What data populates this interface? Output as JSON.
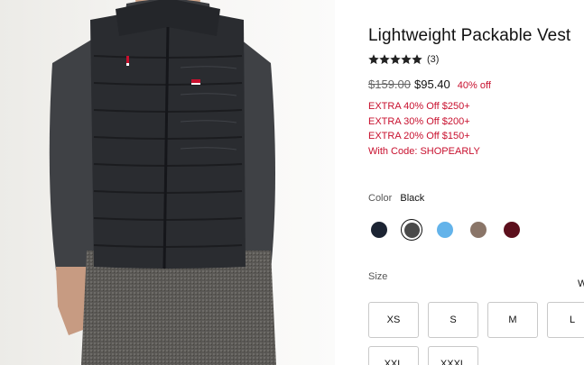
{
  "product": {
    "title": "Lightweight Packable Vest",
    "rating_value": 5,
    "rating_max": 5,
    "review_count": "(3)",
    "price_original": "$159.00",
    "price_sale": "$95.40",
    "discount": "40% off"
  },
  "promos": [
    "EXTRA 40% Off $250+",
    "EXTRA 30% Off $200+",
    "EXTRA 20% Off $150+",
    "With Code: SHOPEARLY"
  ],
  "color": {
    "label": "Color",
    "selected": "Black",
    "swatches": [
      {
        "name": "navy",
        "hex": "#1c2433",
        "selected": false
      },
      {
        "name": "black",
        "hex": "#4a4a4a",
        "selected": true
      },
      {
        "name": "light-blue",
        "hex": "#63b3ea",
        "selected": false
      },
      {
        "name": "taupe",
        "hex": "#8a7568",
        "selected": false
      },
      {
        "name": "burgundy",
        "hex": "#5c0f1c",
        "selected": false
      }
    ]
  },
  "size": {
    "label": "Size",
    "guide_partial": "W",
    "options": [
      "XS",
      "S",
      "M",
      "L",
      "XXL",
      "XXXL"
    ]
  },
  "colors": {
    "sale_red": "#c8102e",
    "star": "#222222"
  },
  "icons": {
    "star": "star-icon"
  }
}
